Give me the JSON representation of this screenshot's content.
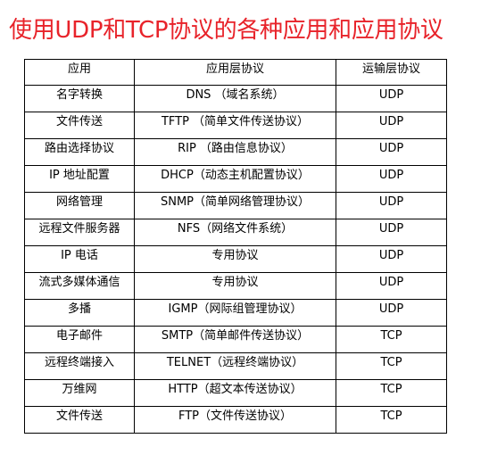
{
  "title": "使用UDP和TCP协议的各种应用和应用协议",
  "table": {
    "headers": [
      "应用",
      "应用层协议",
      "运输层协议"
    ],
    "rows": [
      [
        "名字转换",
        "DNS （域名系统）",
        "UDP"
      ],
      [
        "文件传送",
        "TFTP （简单文件传送协议）",
        "UDP"
      ],
      [
        "路由选择协议",
        "RIP （路由信息协议）",
        "UDP"
      ],
      [
        "IP 地址配置",
        "DHCP（动态主机配置协议）",
        "UDP"
      ],
      [
        "网络管理",
        "SNMP（简单网络管理协议）",
        "UDP"
      ],
      [
        "远程文件服务器",
        "NFS（网络文件系统）",
        "UDP"
      ],
      [
        "IP 电话",
        "专用协议",
        "UDP"
      ],
      [
        "流式多媒体通信",
        "专用协议",
        "UDP"
      ],
      [
        "多播",
        "IGMP（网际组管理协议）",
        "UDP"
      ],
      [
        "电子邮件",
        "SMTP（简单邮件传送协议）",
        "TCP"
      ],
      [
        "远程终端接入",
        "TELNET（远程终端协议）",
        "TCP"
      ],
      [
        "万维网",
        "HTTP（超文本传送协议）",
        "TCP"
      ],
      [
        "文件传送",
        "FTP（文件传送协议）",
        "TCP"
      ]
    ]
  }
}
